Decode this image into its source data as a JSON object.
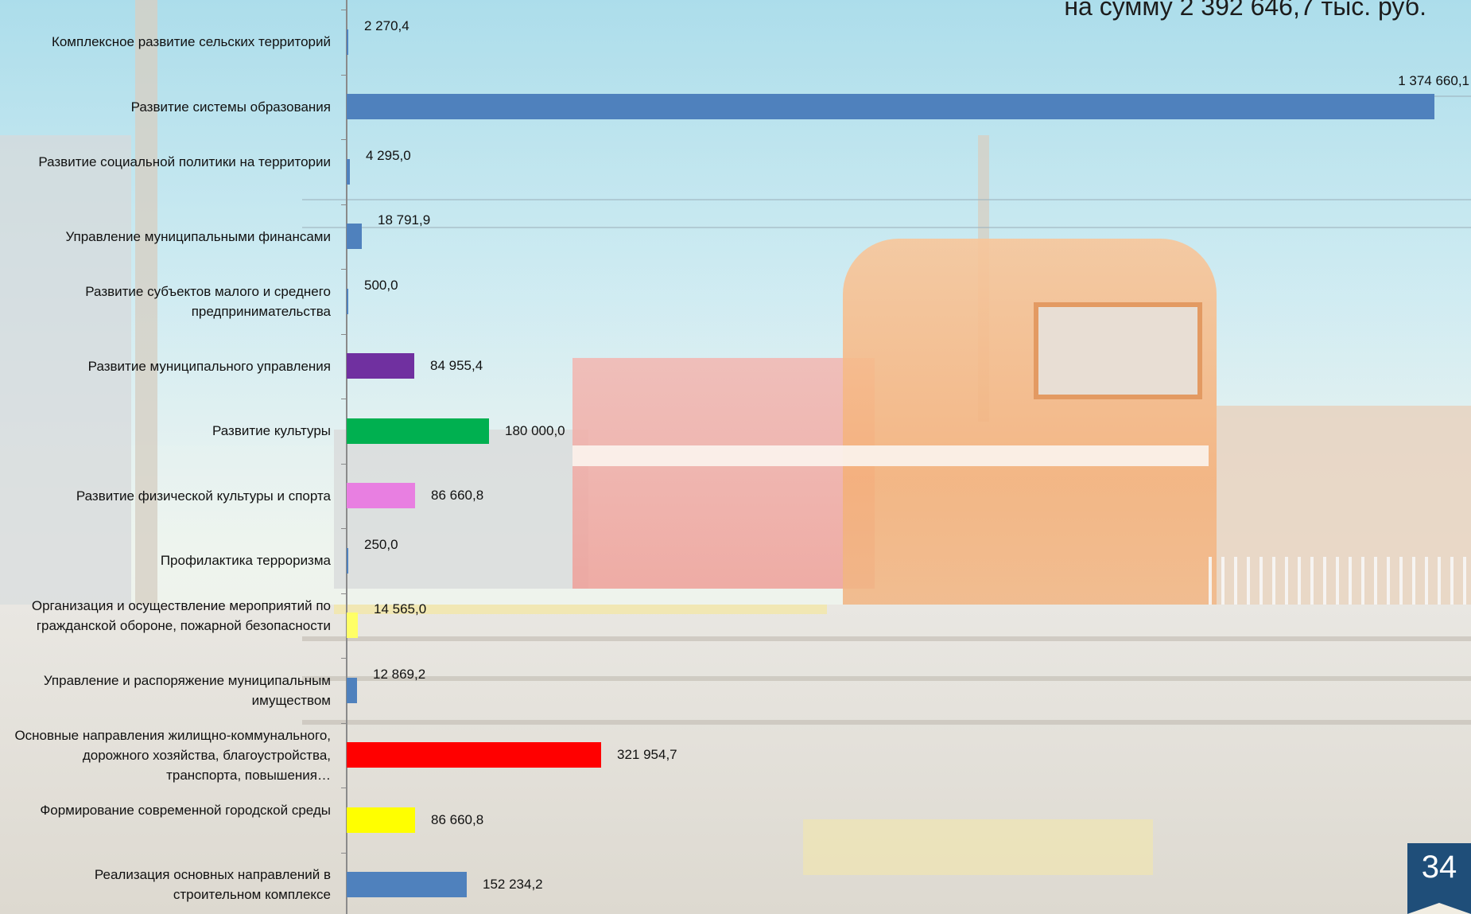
{
  "slide": {
    "title": "на сумму 2 392 646,7 тыс. руб.",
    "page_number": "34"
  },
  "chart_data": {
    "type": "bar",
    "orientation": "horizontal",
    "title": "на сумму 2 392 646,7 тыс. руб.",
    "xlim": [
      0,
      1374660.1
    ],
    "grid": false,
    "legend": "none",
    "categories": [
      "Комплексное развитие сельских территорий",
      "Развитие системы образования",
      "Развитие социальной политики на территории",
      "Управление муниципальными финансами",
      "Развитие субъектов малого и среднего предпринимательства",
      "Развитие муниципального управления",
      "Развитие культуры",
      "Развитие физической культуры и спорта",
      "Профилактика терроризма",
      "Организация и осуществление мероприятий по гражданской обороне, пожарной безопасности",
      "Управление и распоряжение муниципальным имуществом",
      "Основные направления жилищно-коммунального, дорожного хозяйства, благоустройства, транспорта, повышения…",
      "Формирование современной городской среды",
      "Реализация основных направлений в строительном комплексе"
    ],
    "values": [
      2270.4,
      1374660.1,
      4295.0,
      18791.9,
      500.0,
      84955.4,
      180000.0,
      86660.8,
      250.0,
      14565.0,
      12869.2,
      321954.7,
      86660.8,
      152234.2
    ],
    "value_labels": [
      "2 270,4",
      "1 374 660,1",
      "4 295,0",
      "18 791,9",
      "500,0",
      "84 955,4",
      "180 000,0",
      "86 660,8",
      "250,0",
      "14 565,0",
      "12 869,2",
      "321 954,7",
      "86 660,8",
      "152 234,2"
    ],
    "colors": [
      "#4f81bd",
      "#4f81bd",
      "#4f81bd",
      "#4f81bd",
      "#4f81bd",
      "#7030a0",
      "#00b050",
      "#e87fe1",
      "#4f81bd",
      "#ffff66",
      "#4f81bd",
      "#ff0000",
      "#ffff00",
      "#4f81bd"
    ]
  }
}
